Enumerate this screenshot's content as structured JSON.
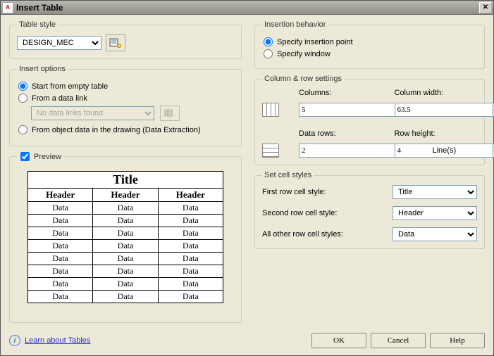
{
  "titlebar": {
    "icon_text": "A",
    "title": "Insert Table"
  },
  "tableStyle": {
    "legend": "Table style",
    "selected": "DESIGN_MEC"
  },
  "insertOptions": {
    "legend": "Insert options",
    "options": {
      "empty": "Start from empty table",
      "datalink": "From a data link",
      "extraction": "From object data in the drawing (Data Extraction)"
    },
    "datalink_placeholder": "No data links found",
    "selected": "empty"
  },
  "preview": {
    "legend": "Preview",
    "checked": true,
    "title": "Title",
    "headers": [
      "Header",
      "Header",
      "Header"
    ],
    "rows": [
      [
        "Data",
        "Data",
        "Data"
      ],
      [
        "Data",
        "Data",
        "Data"
      ],
      [
        "Data",
        "Data",
        "Data"
      ],
      [
        "Data",
        "Data",
        "Data"
      ],
      [
        "Data",
        "Data",
        "Data"
      ],
      [
        "Data",
        "Data",
        "Data"
      ],
      [
        "Data",
        "Data",
        "Data"
      ],
      [
        "Data",
        "Data",
        "Data"
      ]
    ]
  },
  "insertionBehavior": {
    "legend": "Insertion behavior",
    "options": {
      "point": "Specify insertion point",
      "window": "Specify window"
    },
    "selected": "point"
  },
  "colrow": {
    "legend": "Column & row settings",
    "columns_label": "Columns:",
    "columns_value": "5",
    "colwidth_label": "Column width:",
    "colwidth_value": "63.5",
    "datarows_label": "Data rows:",
    "datarows_value": "2",
    "rowheight_label": "Row height:",
    "rowheight_value": "4",
    "lines_label": "Line(s)"
  },
  "cellStyles": {
    "legend": "Set cell styles",
    "first_label": "First row cell style:",
    "first_value": "Title",
    "second_label": "Second row cell style:",
    "second_value": "Header",
    "others_label": "All other row cell styles:",
    "others_value": "Data"
  },
  "footer": {
    "learn_label": "Learn about Tables",
    "ok": "OK",
    "cancel": "Cancel",
    "help": "Help"
  }
}
